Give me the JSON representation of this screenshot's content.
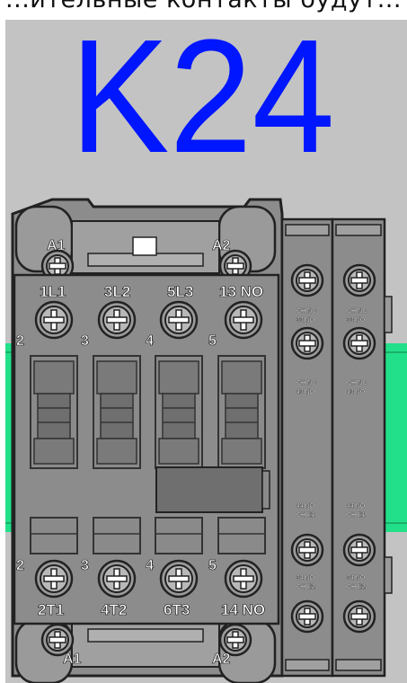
{
  "header": {
    "text": "...ительные контакты будут..."
  },
  "device": {
    "tag": "K24",
    "coil_top": [
      "A1",
      "A2"
    ],
    "coil_bottom": [
      "A1",
      "A2"
    ],
    "top_terminals": [
      "1L1",
      "3L2",
      "5L3",
      "13 NO"
    ],
    "bottom_terminals": [
      "2T1",
      "4T2",
      "6T3",
      "14 NO"
    ],
    "top_side_numbers": [
      "2",
      "3",
      "4",
      "5"
    ],
    "bottom_side_numbers": [
      "2",
      "3",
      "4",
      "5"
    ]
  },
  "aux_block_1": {
    "top_label_1": "CH NC",
    "top_label_2": "33 NO",
    "mid_label_1": "CH NC",
    "mid_label_2": "43 NO",
    "low_label_1": "44 NO",
    "low_label_2": "CH E1",
    "bottom_label_1": "34 NO",
    "bottom_label_2": "CH E2"
  },
  "aux_block_2": {
    "top_label_1": "CH NC",
    "top_label_2": "33 NO",
    "mid_label_1": "CH NC",
    "mid_label_2": "43 NO",
    "low_label_1": "44 NO",
    "low_label_2": "CH E1",
    "bottom_label_1": "34 NO",
    "bottom_label_2": "CH E2"
  },
  "colors": {
    "rail": "#22e08a",
    "tag": "#0016ff",
    "body": "#8c8c8c",
    "background": "#c3c3c3"
  }
}
